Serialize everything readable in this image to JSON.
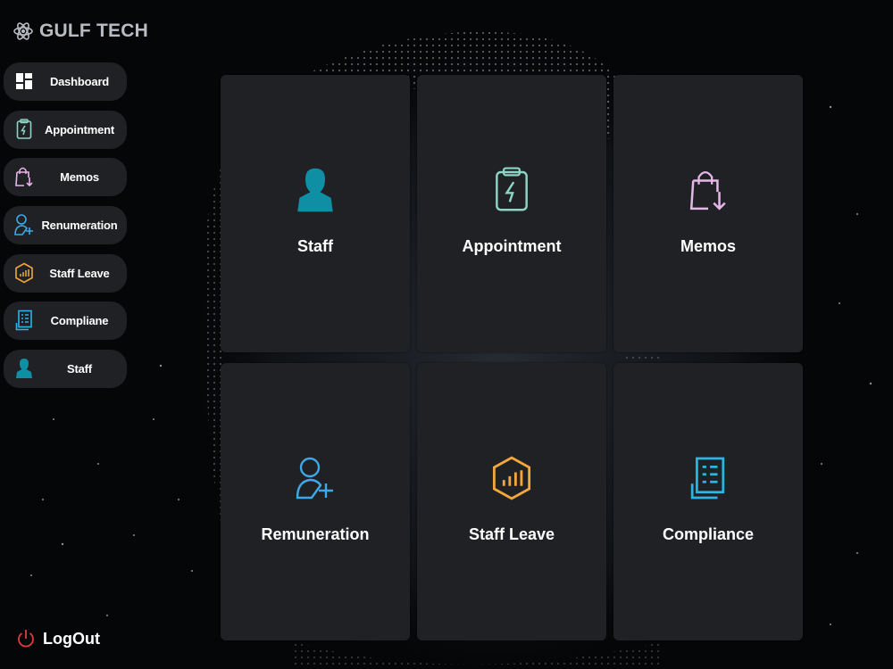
{
  "brand": {
    "name": "GULF TECH",
    "icon": "atom-icon"
  },
  "sidebar": {
    "items": [
      {
        "label": "Dashboard",
        "icon": "dashboard-grid-icon",
        "color": "#ffffff"
      },
      {
        "label": "Appointment",
        "icon": "clipboard-bolt-icon",
        "color": "#8fd3c4"
      },
      {
        "label": "Memos",
        "icon": "shopping-bag-download-icon",
        "color": "#e7b6e8"
      },
      {
        "label": "Renumeration",
        "icon": "user-add-icon",
        "color": "#3fa8e8"
      },
      {
        "label": "Staff Leave",
        "icon": "hexagon-chart-icon",
        "color": "#f2a73b"
      },
      {
        "label": "Compliane",
        "icon": "document-list-icon",
        "color": "#2bb5e6"
      },
      {
        "label": "Staff",
        "icon": "person-icon",
        "color": "#0e8fa3"
      }
    ]
  },
  "logout": {
    "label": "LogOut",
    "icon": "power-icon",
    "color": "#e03b3b"
  },
  "cards": [
    {
      "label": "Staff",
      "icon": "person-icon",
      "color": "#0e8fa3"
    },
    {
      "label": "Appointment",
      "icon": "clipboard-bolt-icon",
      "color": "#8fd3c4"
    },
    {
      "label": "Memos",
      "icon": "shopping-bag-download-icon",
      "color": "#e7b6e8"
    },
    {
      "label": "Remuneration",
      "icon": "user-add-icon",
      "color": "#3fa8e8"
    },
    {
      "label": "Staff Leave",
      "icon": "hexagon-chart-icon",
      "color": "#f2a73b"
    },
    {
      "label": "Compliance",
      "icon": "document-list-icon",
      "color": "#2bb5e6"
    }
  ]
}
